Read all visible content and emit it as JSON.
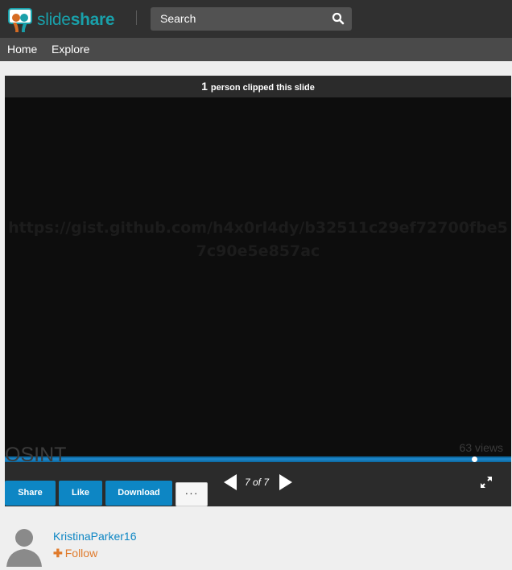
{
  "header": {
    "logo_text_1": "slide",
    "logo_text_2": "share",
    "search_label": "Search"
  },
  "nav": {
    "items": [
      {
        "label": "Home"
      },
      {
        "label": "Explore"
      }
    ]
  },
  "player": {
    "clip_count": "1",
    "clip_text": "person clipped this slide",
    "slide_text_line1": "https://gist.github.com/h4x0rl4dy/b32511c29ef72700fbe5",
    "slide_text_line2": "7c90e5e857ac",
    "page_indicator": "7 of 7",
    "progress": 1.0
  },
  "document": {
    "title": "OSINT",
    "views": "63 views"
  },
  "actions": {
    "share_label": "Share",
    "like_label": "Like",
    "download_label": "Download",
    "more_label": "···"
  },
  "author": {
    "name": "KristinaParker16",
    "follow_label": "Follow"
  },
  "colors": {
    "brand": "#19a0aa",
    "button_blue": "#0d86c4",
    "follow_orange": "#e07a2b"
  },
  "icons": [
    "slideshare-logo-icon",
    "search-icon",
    "prev-arrow-icon",
    "next-arrow-icon",
    "fullscreen-icon",
    "avatar-icon",
    "plus-icon"
  ]
}
